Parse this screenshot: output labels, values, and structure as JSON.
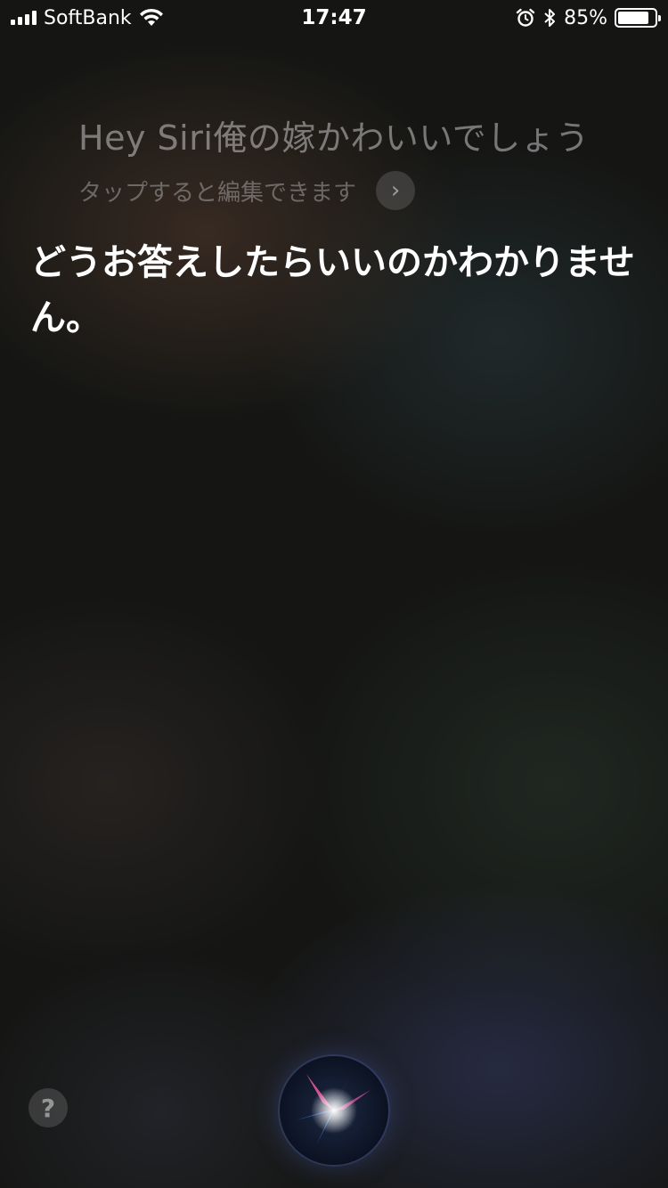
{
  "status_bar": {
    "carrier": "SoftBank",
    "time": "17:47",
    "battery": "85%",
    "battery_level": 0.85,
    "icons": [
      "signal-icon",
      "wifi-icon",
      "alarm-icon",
      "bluetooth-icon",
      "battery-icon"
    ]
  },
  "siri": {
    "query": "Hey Siri俺の嫁かわいいでしょう",
    "edit_hint": "タップすると編集できます",
    "response": "どうお答えしたらいいのかわかりません。"
  },
  "controls": {
    "help_label": "?",
    "edit_arrow_label": "›",
    "icons": [
      "chevron-right-icon",
      "question-icon",
      "siri-orb-icon"
    ]
  }
}
